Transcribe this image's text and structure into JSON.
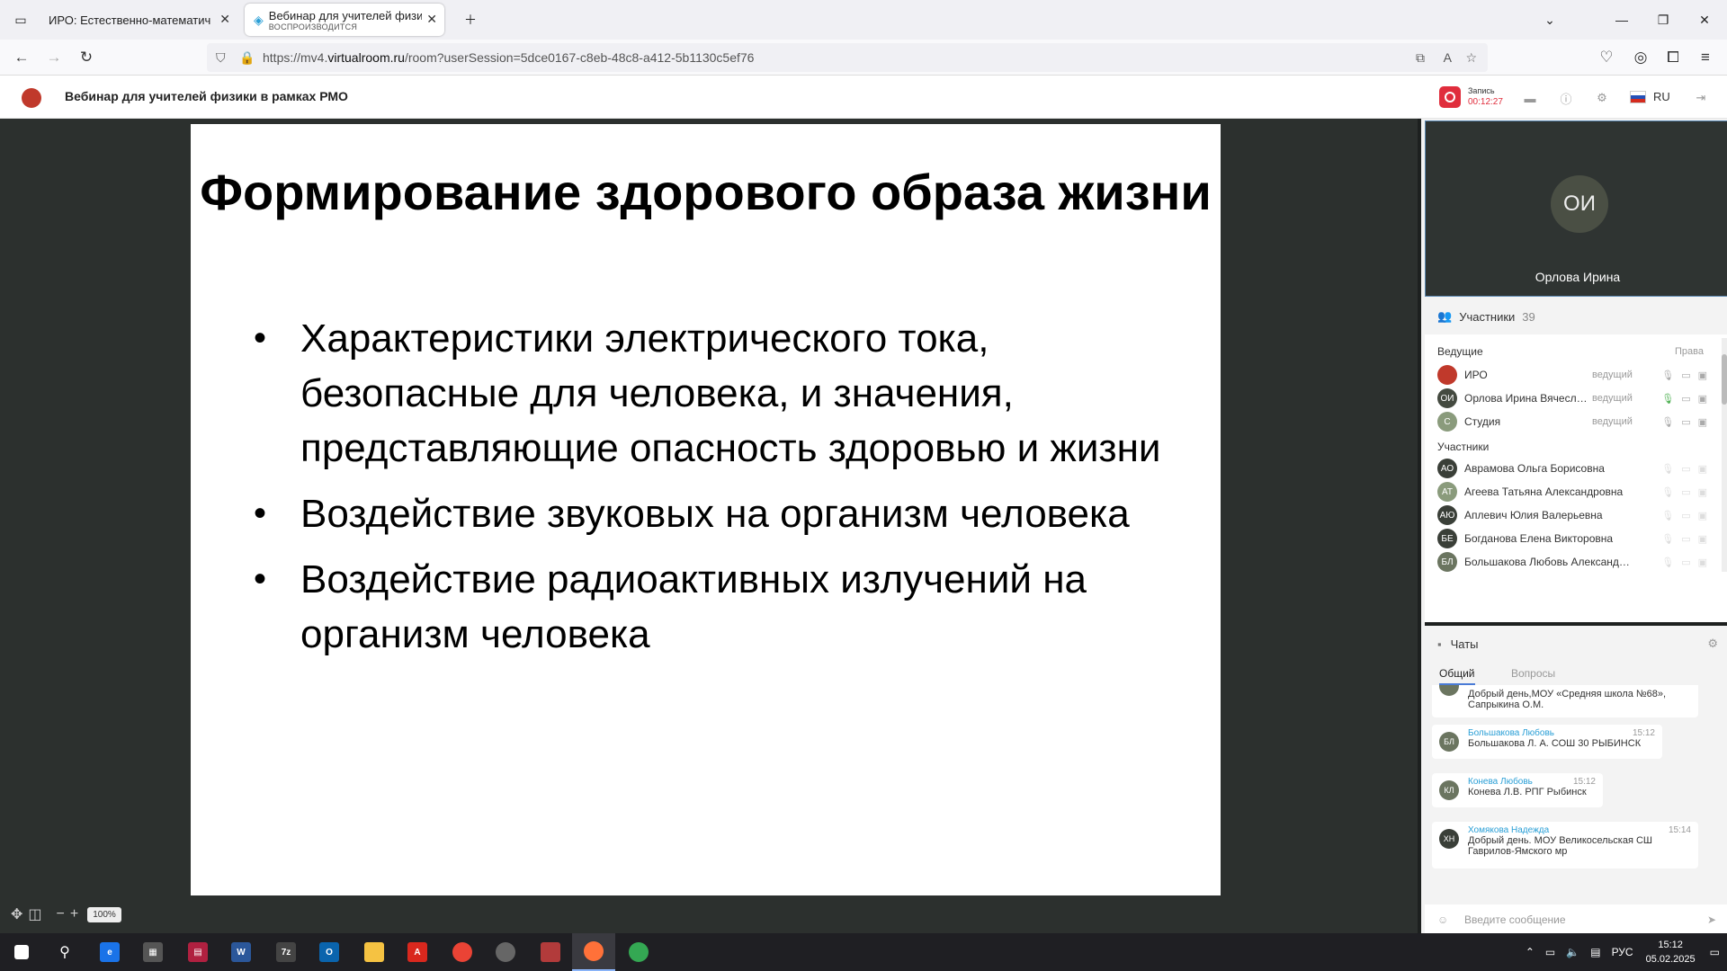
{
  "browser": {
    "tabs": [
      {
        "title": "ИРО: Естественно-математических"
      },
      {
        "title": "Вебинар для учителей физики",
        "status": "ВОСПРОИЗВОДИТСЯ"
      }
    ],
    "url_prefix": "https://mv4.",
    "url_host": "virtualroom.ru",
    "url_path": "/room?userSession=5dce0167-c8eb-48c8-a412-5b1130c5ef76"
  },
  "app": {
    "title": "Вебинар для учителей физики в рамках РМО",
    "record_label": "Запись",
    "record_time": "00:12:27",
    "language": "RU"
  },
  "slide": {
    "title": "Формирование здорового образа жизни",
    "bullets": [
      "Характеристики электрического тока, безопасные для человека, и значения, представляющие опасность здоровью и жизни",
      "Воздействие звуковых на организм человека",
      "Воздействие радиоактивных излучений на организм человека"
    ],
    "zoom": "100%"
  },
  "video": {
    "initials": "ОИ",
    "name": "Орлова Ирина"
  },
  "participants": {
    "title": "Участники",
    "count": "39",
    "hosts_label": "Ведущие",
    "rights_label": "Права",
    "hosts": [
      {
        "initials": "",
        "name": "ИРО",
        "role": "ведущий",
        "color": "#c0392b"
      },
      {
        "initials": "ОИ",
        "name": "Орлова Ирина Вячеславовна",
        "role": "ведущий",
        "color": "#444a40"
      },
      {
        "initials": "С",
        "name": "Студия",
        "role": "ведущий",
        "color": "#8a9b7c"
      }
    ],
    "members_label": "Участники",
    "members": [
      {
        "initials": "АО",
        "name": "Аврамова Ольга Борисовна",
        "color": "#3a3f38"
      },
      {
        "initials": "АТ",
        "name": "Агеева Татьяна Александровна",
        "color": "#8a9b7c"
      },
      {
        "initials": "АЮ",
        "name": "Аплевич Юлия Валерьевна",
        "color": "#3a3f38"
      },
      {
        "initials": "БЕ",
        "name": "Богданова Елена Викторовна",
        "color": "#3a3f38"
      },
      {
        "initials": "БЛ",
        "name": "Большакова Любовь Александровна",
        "color": "#6b7560"
      }
    ]
  },
  "chat": {
    "title": "Чаты",
    "tabs": [
      "Общий",
      "Вопросы"
    ],
    "messages": [
      {
        "initials": "",
        "author": "",
        "time": "",
        "text": "Добрый день,МОУ «Средняя школа №68», Сапрыкина О.М.",
        "color": "#6b7560"
      },
      {
        "initials": "БЛ",
        "author": "Большакова Любовь",
        "time": "15:12",
        "text": "Большакова Л. А. СОШ 30 РЫБИНСК",
        "color": "#6b7560"
      },
      {
        "initials": "КЛ",
        "author": "Конева Любовь",
        "time": "15:12",
        "text": "Конева Л.В. РПГ Рыбинск",
        "color": "#6b7560"
      },
      {
        "initials": "ХН",
        "author": "Хомякова Надежда",
        "time": "15:14",
        "text": "Добрый день. МОУ Великосельская СШ Гаврилов-Ямского мр",
        "color": "#3a3f38"
      }
    ],
    "input_placeholder": "Введите сообщение"
  },
  "taskbar": {
    "lang": "РУС",
    "time": "15:12",
    "date": "05.02.2025"
  }
}
